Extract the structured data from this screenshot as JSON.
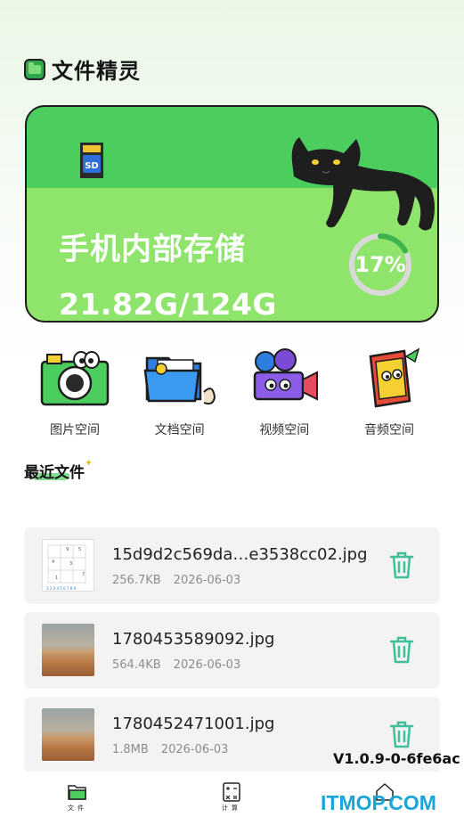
{
  "header": {
    "title": "文件精灵",
    "logo_icon": "folder-icon"
  },
  "storage": {
    "label": "手机内部存储",
    "usage": "21.82G/124G",
    "percent_text": "17%",
    "percent": 17,
    "colors": {
      "card": "#4cce5f",
      "ring_track": "#d9d9d9",
      "ring_fill": "#3db54a"
    }
  },
  "categories": [
    {
      "label": "图片空间",
      "icon": "camera-icon"
    },
    {
      "label": "文档空间",
      "icon": "folder-icon"
    },
    {
      "label": "视频空间",
      "icon": "video-camera-icon"
    },
    {
      "label": "音频空间",
      "icon": "music-book-icon"
    }
  ],
  "recent": {
    "title": "最近文件",
    "files": [
      {
        "name": "15d9d2c569da…e3538cc02.jpg",
        "size": "256.7KB",
        "date": "2026-06-03",
        "thumb": "sudoku"
      },
      {
        "name": "1780453589092.jpg",
        "size": "564.4KB",
        "date": "2026-06-03",
        "thumb": "desert"
      },
      {
        "name": "1780452471001.jpg",
        "size": "1.8MB",
        "date": "2026-06-03",
        "thumb": "desert"
      }
    ]
  },
  "version": "V1.0.9-0-6fe6ac",
  "bottom_nav": [
    {
      "label": "文件",
      "icon": "folder-icon"
    },
    {
      "label": "计算",
      "icon": "calculator-icon"
    },
    {
      "label": "",
      "icon": "home-icon"
    }
  ],
  "watermark": "ITMOP.COM"
}
